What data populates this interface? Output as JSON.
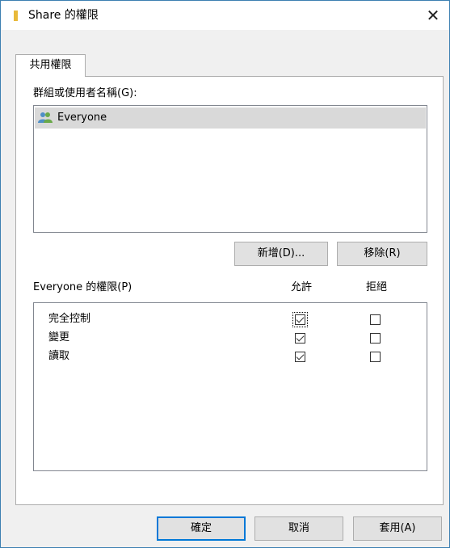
{
  "window": {
    "title": "Share 的權限",
    "close_symbol": "✕"
  },
  "tab": {
    "label": "共用權限"
  },
  "groups": {
    "label": "群組或使用者名稱(G):",
    "items": [
      {
        "name": "Everyone",
        "icon": "users-icon",
        "selected": true
      }
    ]
  },
  "buttons": {
    "add": "新增(D)...",
    "remove": "移除(R)",
    "ok": "確定",
    "cancel": "取消",
    "apply": "套用(A)"
  },
  "permissions": {
    "label": "Everyone 的權限(P)",
    "allow_header": "允許",
    "deny_header": "拒絕",
    "rows": [
      {
        "name": "完全控制",
        "allow": true,
        "deny": false
      },
      {
        "name": "變更",
        "allow": true,
        "deny": false
      },
      {
        "name": "讀取",
        "allow": true,
        "deny": false
      }
    ]
  },
  "colors": {
    "accent": "#0078d7",
    "selection": "#d9d9d9",
    "folder": "#e8b93a",
    "window_border": "#3c7fb1"
  }
}
